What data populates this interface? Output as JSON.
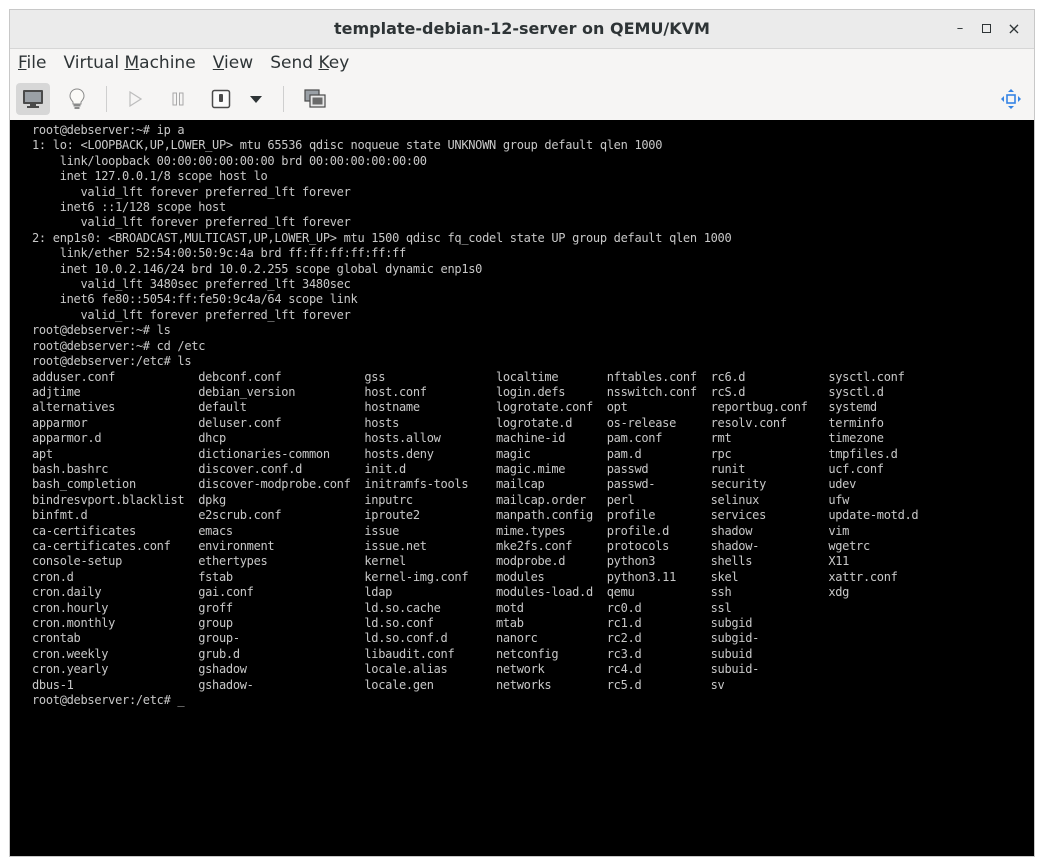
{
  "window": {
    "title": "template-debian-12-server on QEMU/KVM",
    "controls": {
      "minimize": "–",
      "maximize": "▫",
      "close": "×"
    }
  },
  "menu": {
    "file": {
      "pre": "",
      "key": "F",
      "post": "ile"
    },
    "vm": {
      "pre": "Virtual ",
      "key": "M",
      "post": "achine"
    },
    "view": {
      "pre": "",
      "key": "V",
      "post": "iew"
    },
    "sendkey": {
      "pre": "Send ",
      "key": "K",
      "post": "ey"
    }
  },
  "toolbar": {
    "icons": [
      "monitor-icon",
      "lightbulb-icon",
      "play-icon",
      "pause-icon",
      "power-icon",
      "dropdown-icon",
      "snapshot-icon",
      "fullscreen-icon"
    ]
  },
  "terminal": {
    "lines": [
      "root@debserver:~# ip a",
      "1: lo: <LOOPBACK,UP,LOWER_UP> mtu 65536 qdisc noqueue state UNKNOWN group default qlen 1000",
      "    link/loopback 00:00:00:00:00:00 brd 00:00:00:00:00:00",
      "    inet 127.0.0.1/8 scope host lo",
      "       valid_lft forever preferred_lft forever",
      "    inet6 ::1/128 scope host",
      "       valid_lft forever preferred_lft forever",
      "2: enp1s0: <BROADCAST,MULTICAST,UP,LOWER_UP> mtu 1500 qdisc fq_codel state UP group default qlen 1000",
      "    link/ether 52:54:00:50:9c:4a brd ff:ff:ff:ff:ff:ff",
      "    inet 10.0.2.146/24 brd 10.0.2.255 scope global dynamic enp1s0",
      "       valid_lft 3480sec preferred_lft 3480sec",
      "    inet6 fe80::5054:ff:fe50:9c4a/64 scope link",
      "       valid_lft forever preferred_lft forever",
      "root@debserver:~# ls",
      "root@debserver:~# cd /etc",
      "root@debserver:/etc# ls",
      "adduser.conf            debconf.conf            gss                localtime       nftables.conf  rc6.d            sysctl.conf",
      "adjtime                 debian_version          host.conf          login.defs      nsswitch.conf  rcS.d            sysctl.d",
      "alternatives            default                 hostname           logrotate.conf  opt            reportbug.conf   systemd",
      "apparmor                deluser.conf            hosts              logrotate.d     os-release     resolv.conf      terminfo",
      "apparmor.d              dhcp                    hosts.allow        machine-id      pam.conf       rmt              timezone",
      "apt                     dictionaries-common     hosts.deny         magic           pam.d          rpc              tmpfiles.d",
      "bash.bashrc             discover.conf.d         init.d             magic.mime      passwd         runit            ucf.conf",
      "bash_completion         discover-modprobe.conf  initramfs-tools    mailcap         passwd-        security         udev",
      "bindresvport.blacklist  dpkg                    inputrc            mailcap.order   perl           selinux          ufw",
      "binfmt.d                e2scrub.conf            iproute2           manpath.config  profile        services         update-motd.d",
      "ca-certificates         emacs                   issue              mime.types      profile.d      shadow           vim",
      "ca-certificates.conf    environment             issue.net          mke2fs.conf     protocols      shadow-          wgetrc",
      "console-setup           ethertypes              kernel             modprobe.d      python3        shells           X11",
      "cron.d                  fstab                   kernel-img.conf    modules         python3.11     skel             xattr.conf",
      "cron.daily              gai.conf                ldap               modules-load.d  qemu           ssh              xdg",
      "cron.hourly             groff                   ld.so.cache        motd            rc0.d          ssl",
      "cron.monthly            group                   ld.so.conf         mtab            rc1.d          subgid",
      "crontab                 group-                  ld.so.conf.d       nanorc          rc2.d          subgid-",
      "cron.weekly             grub.d                  libaudit.conf      netconfig       rc3.d          subuid",
      "cron.yearly             gshadow                 locale.alias       network         rc4.d          subuid-",
      "dbus-1                  gshadow-                locale.gen         networks        rc5.d          sv"
    ],
    "prompt": "root@debserver:/etc# ",
    "cursor": "_"
  }
}
